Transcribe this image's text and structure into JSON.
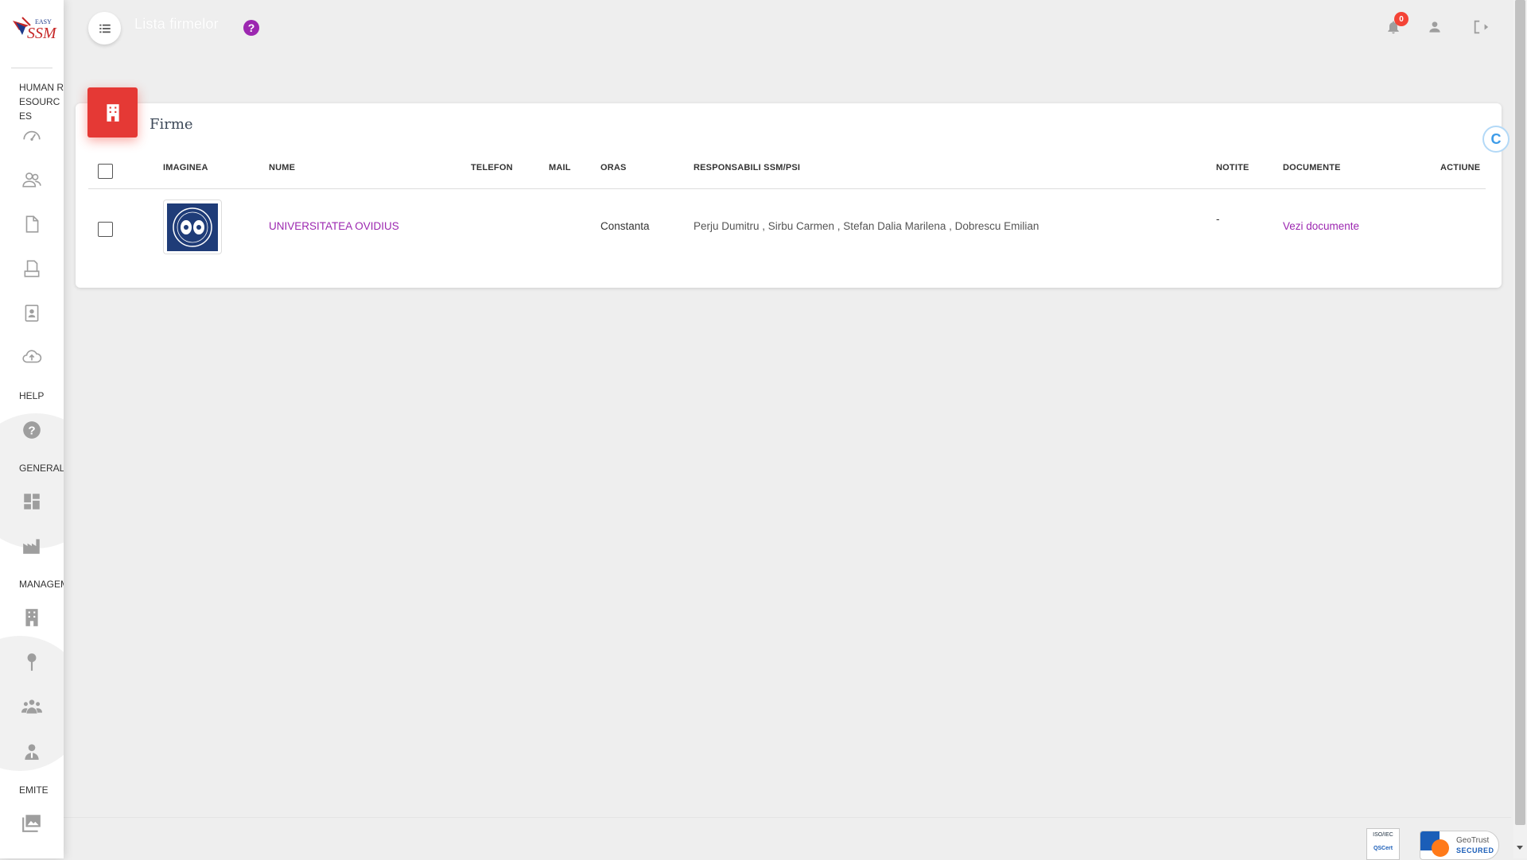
{
  "app": {
    "logo_text_top": "EASY",
    "logo_text_main": "SSM",
    "page_title": "Lista firmelor",
    "help_mark": "?",
    "notifications_count": "0"
  },
  "sidebar": {
    "sections": [
      {
        "label": "HUMAN RESOURCES"
      },
      {
        "label": "HELP"
      },
      {
        "label": "GENERALE"
      },
      {
        "label": "MANAGEMENT"
      },
      {
        "label": "EMITE"
      }
    ],
    "icons": [
      "dashboard-gauge-icon",
      "people-icon",
      "document-icon",
      "printer-doc-icon",
      "badge-icon",
      "cloud-upload-icon",
      "help-circle-icon",
      "dashboard-grid-icon",
      "factory-icon",
      "building-icon",
      "pin-icon",
      "group-icon",
      "worker-icon",
      "gallery-icon"
    ]
  },
  "card": {
    "title": "Firme",
    "float_button": "C"
  },
  "table": {
    "headers": [
      "IMAGINEA",
      "NUME",
      "TELEFON",
      "MAIL",
      "ORAS",
      "RESPONSABILI SSM/PSI",
      "NOTITE",
      "DOCUMENTE",
      "ACTIUNE"
    ],
    "rows": [
      {
        "name": "UNIVERSITATEA OVIDIUS",
        "phone": "",
        "mail": "",
        "city": "Constanta",
        "responsible": "Perju Dumitru , Sirbu Carmen , Stefan Dalia Marilena , Dobrescu Emilian",
        "notes": "-",
        "documents": "Vezi documente",
        "action": ""
      }
    ]
  },
  "footer": {
    "badge1_line1": "ISO/IEC",
    "badge1_line2": "QSCert",
    "badge2_line1": "GeoTrust",
    "badge2_line2": "SECURED"
  },
  "colors": {
    "accent": "#9c27b0",
    "card_icon_bg": "#e53935",
    "notification": "#f44336",
    "background": "#eeeeee"
  }
}
